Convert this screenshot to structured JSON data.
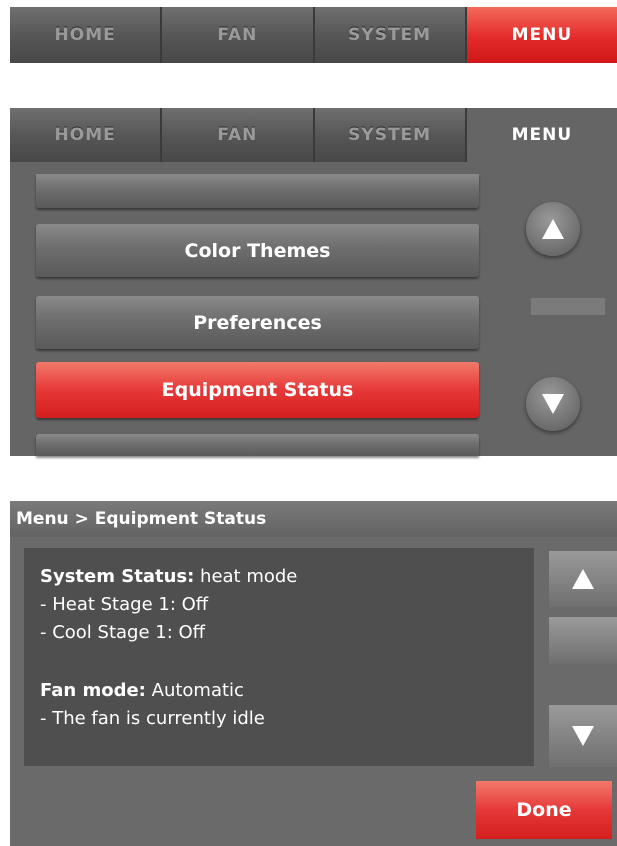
{
  "nav": {
    "tabs": [
      "HOME",
      "FAN",
      "SYSTEM",
      "MENU"
    ],
    "active_tab": "MENU"
  },
  "menu_list": {
    "items": [
      "Color Themes",
      "Preferences",
      "Equipment Status"
    ],
    "selected": "Equipment Status",
    "scroll_up_icon": "triangle-up-icon",
    "scroll_down_icon": "triangle-down-icon"
  },
  "equipment_status": {
    "breadcrumb": "Menu > Equipment Status",
    "system_status_label": "System Status:",
    "system_status_value": "heat mode",
    "heat_stage": "- Heat Stage 1: Off",
    "cool_stage": "- Cool Stage 1: Off",
    "fan_mode_label": "Fan mode:",
    "fan_mode_value": "Automatic",
    "fan_state": "- The fan is currently idle",
    "done_label": "Done"
  },
  "colors": {
    "accent_red": "#e42a2a",
    "panel_grey": "#656565",
    "content_dark": "#4f4f4f"
  }
}
